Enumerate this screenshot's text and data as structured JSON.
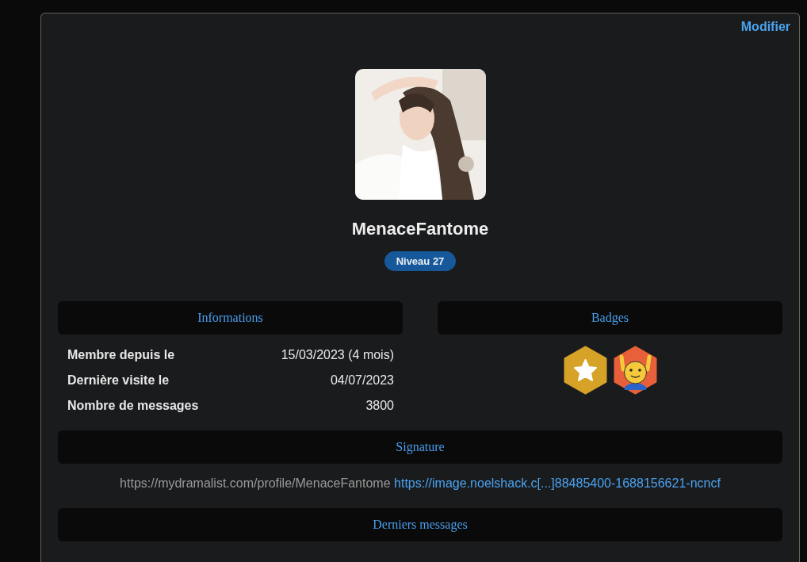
{
  "edit_link": "Modifier",
  "profile": {
    "username": "MenaceFantome",
    "level_badge": "Niveau 27"
  },
  "informations": {
    "title": "Informations",
    "rows": [
      {
        "label": "Membre depuis le",
        "value": "15/03/2023 (4 mois)"
      },
      {
        "label": "Dernière visite le",
        "value": "04/07/2023"
      },
      {
        "label": "Nombre de messages",
        "value": "3800"
      }
    ]
  },
  "badges": {
    "title": "Badges",
    "items": [
      {
        "kind": "star",
        "color": "#d6a227"
      },
      {
        "kind": "smiley",
        "color": "#e8603a"
      }
    ]
  },
  "signature": {
    "title": "Signature",
    "text": "https://mydramalist.com/profile/MenaceFantome",
    "link": "https://image.noelshack.c[...]88485400-1688156621-ncncf"
  },
  "latest_messages": {
    "title": "Derniers messages"
  }
}
